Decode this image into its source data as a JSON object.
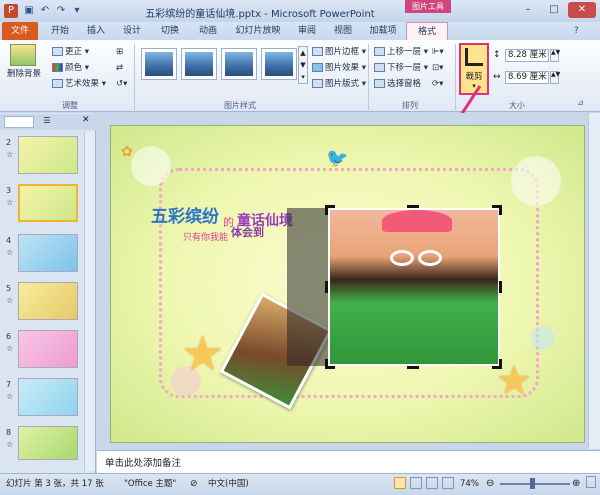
{
  "titlebar": {
    "title": "五彩缤纷的童话仙境.pptx - Microsoft PowerPoint",
    "context_band": "图片工具",
    "icons": [
      "save-icon",
      "undo-icon",
      "redo-icon",
      "customize-icon"
    ],
    "window_controls": [
      "minimize-icon",
      "maximize-icon",
      "close-icon"
    ]
  },
  "tabs": [
    "文件",
    "开始",
    "插入",
    "设计",
    "切换",
    "动画",
    "幻灯片放映",
    "审阅",
    "视图",
    "加载项",
    "格式"
  ],
  "ribbon": {
    "adjust": {
      "remove_bg": "删除背景",
      "corrections": "更正",
      "color": "颜色",
      "artistic": "艺术效果",
      "label": "调整"
    },
    "styles": {
      "border": "图片边框",
      "effects": "图片效果",
      "layout": "图片版式",
      "label": "图片样式"
    },
    "arrange": {
      "bring_forward": "上移一层",
      "send_backward": "下移一层",
      "selection_pane": "选择窗格",
      "label": "排列"
    },
    "size": {
      "crop": "裁剪",
      "height": "8.28 厘米",
      "width": "8.69 厘米",
      "label": "大小"
    }
  },
  "slides_pane": {
    "numbers": [
      "2",
      "3",
      "4",
      "5",
      "6",
      "7",
      "8"
    ],
    "star_marker": "☆",
    "selected": "3"
  },
  "slide": {
    "title_main": "五彩缤纷",
    "title_de": "的",
    "title_rest": "童话仙境",
    "sub1": "只有你我能",
    "sub2": "体会到"
  },
  "notes": {
    "placeholder": "单击此处添加备注"
  },
  "status": {
    "slide_info": "幻灯片 第 3 张，共 17 张",
    "theme": "\"Office 主题\"",
    "language": "中文(中国)",
    "zoom": "74%"
  },
  "colors": {
    "accent_pink": "#e0307a",
    "file_tab": "#d85a1f",
    "ribbon_bg": "#dfe8f4"
  }
}
